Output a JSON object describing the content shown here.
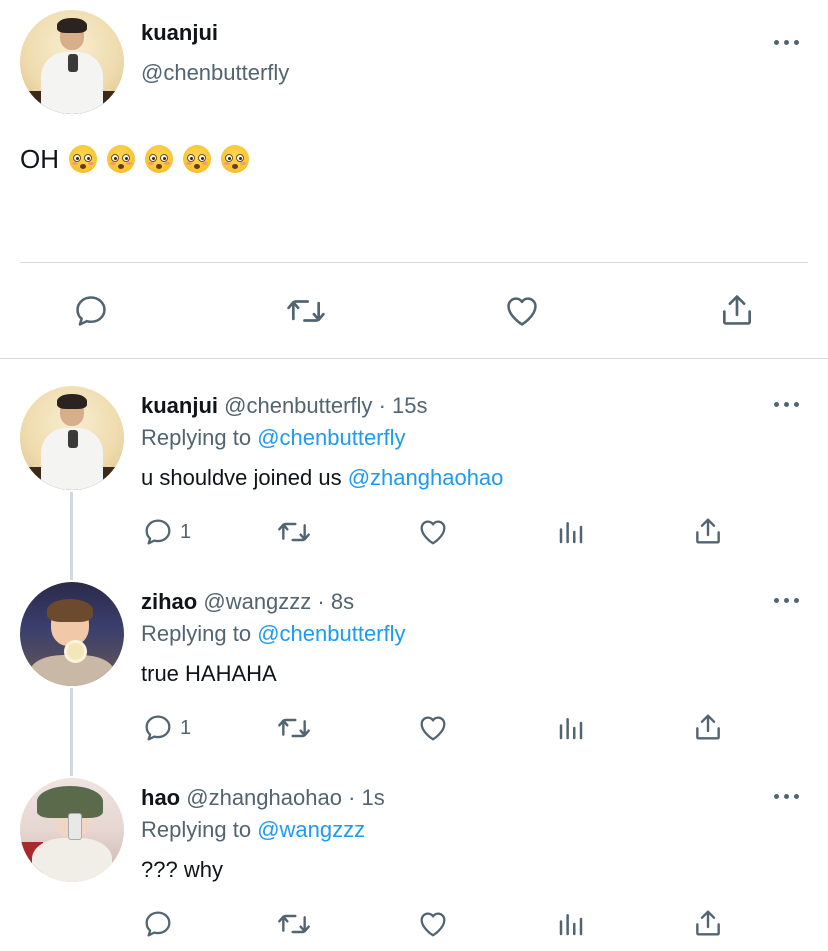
{
  "main_tweet": {
    "name": "kuanjui",
    "handle": "@chenbutterfly",
    "text": "OH",
    "emojis": [
      "flushed-face",
      "flushed-face",
      "flushed-face",
      "flushed-face",
      "flushed-face"
    ]
  },
  "replies": [
    {
      "name": "kuanjui",
      "handle": "@chenbutterfly",
      "time": "· 15s",
      "replying_label": "Replying to",
      "replying_handle": "@chenbutterfly",
      "text": "u shouldve joined us",
      "mention": "@zhanghaohao",
      "reply_count": "1"
    },
    {
      "name": "zihao",
      "handle": "@wangzzz",
      "time": "· 8s",
      "replying_label": "Replying to",
      "replying_handle": "@chenbutterfly",
      "text": "true HAHAHA",
      "mention": "",
      "reply_count": "1"
    },
    {
      "name": "hao",
      "handle": "@zhanghaohao",
      "time": "· 1s",
      "replying_label": "Replying to",
      "replying_handle": "@wangzzz",
      "text": "??? why",
      "mention": "",
      "reply_count": ""
    }
  ],
  "icons": [
    "reply-icon",
    "retweet-icon",
    "like-icon",
    "views-icon",
    "share-icon",
    "more-icon"
  ],
  "colors": {
    "link": "#1d9bf0",
    "secondary_text": "#536471",
    "icon": "#536471",
    "divider": "#d6dbdf"
  }
}
